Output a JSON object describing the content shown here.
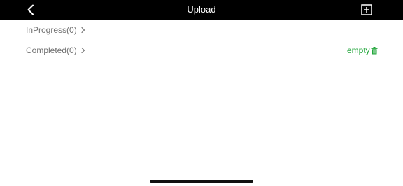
{
  "nav": {
    "title": "Upload",
    "back_icon": "chevron-left-icon",
    "add_icon": "add-square-icon"
  },
  "sections": {
    "in_progress": {
      "label": "InProgress(0)"
    },
    "completed": {
      "label": "Completed(0)",
      "action_label": "empty",
      "action_icon": "trash-icon"
    }
  },
  "colors": {
    "nav_background": "#000000",
    "accent_green": "#22a63b",
    "label_gray": "#6f6f6f"
  }
}
